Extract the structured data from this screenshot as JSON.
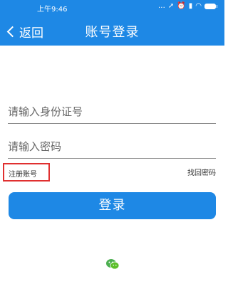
{
  "status_bar": {
    "time": "上午9:46",
    "icons": [
      "more-icon",
      "location-icon",
      "alarm-icon",
      "signal-icon",
      "wifi-icon",
      "battery-icon"
    ]
  },
  "nav": {
    "back_label": "返回",
    "title": "账号登录"
  },
  "form": {
    "id_placeholder": "请输入身份证号",
    "password_placeholder": "请输入密码"
  },
  "links": {
    "register": "注册账号",
    "forgot_password": "找回密码"
  },
  "login_button": "登录",
  "social": {
    "wechat_icon": "wechat-icon"
  },
  "colors": {
    "primary": "#1e88e5",
    "highlight_border": "#e03030"
  }
}
